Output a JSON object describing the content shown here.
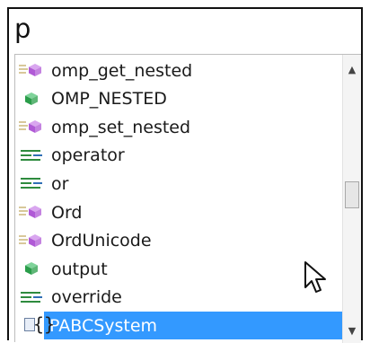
{
  "search": {
    "query": "p"
  },
  "list": {
    "items": [
      {
        "label": "omp_get_nested",
        "kind": "method"
      },
      {
        "label": "OMP_NESTED",
        "kind": "constant"
      },
      {
        "label": "omp_set_nested",
        "kind": "method"
      },
      {
        "label": "operator",
        "kind": "keyword"
      },
      {
        "label": "or",
        "kind": "keyword"
      },
      {
        "label": "Ord",
        "kind": "method"
      },
      {
        "label": "OrdUnicode",
        "kind": "method"
      },
      {
        "label": "output",
        "kind": "constant"
      },
      {
        "label": "override",
        "kind": "keyword"
      },
      {
        "label": "PABCSystem",
        "kind": "namespace",
        "selected": true
      }
    ]
  },
  "colors": {
    "selection": "#3399ff",
    "method_cube": "#b05ad6",
    "constant_cube": "#2a9d4a",
    "keyword_lines": "#2e8b3e"
  }
}
